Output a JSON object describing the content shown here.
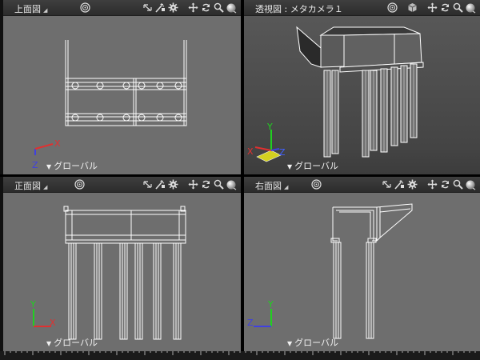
{
  "panes": {
    "top": {
      "title": "上面図",
      "projection": "グローバル"
    },
    "perspective": {
      "title": "透視図 : メタカメラ１",
      "projection": "グローバル"
    },
    "front": {
      "title": "正面図",
      "projection": "グローバル"
    },
    "right": {
      "title": "右面図",
      "projection": "グローバル"
    }
  },
  "icons": {
    "center": "target-icon",
    "cube": "cube-icon",
    "fit": "fit-icon",
    "wand": "wand-icon",
    "gear": "gear-icon",
    "move": "move-icon",
    "rotate": "rotate-icon",
    "zoom": "zoom-icon",
    "render": "render-ball-icon"
  },
  "axes": {
    "x": "X",
    "y": "Y",
    "z": "Z"
  },
  "colors": {
    "viewport_bg": "#6e6e6e",
    "header_bg": "#333333",
    "wire": "#ffffff",
    "axis_x": "#e03030",
    "axis_y": "#20d020",
    "axis_z": "#4040e0"
  }
}
